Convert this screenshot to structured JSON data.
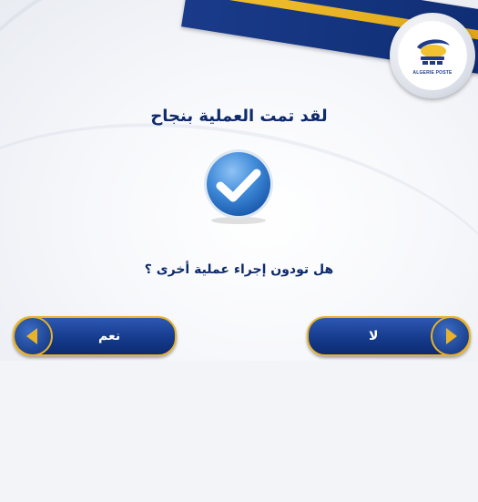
{
  "dialog": {
    "title": "لقد تمت العملية بنجاح",
    "question": "هل تودون إجراء عملية أخرى ؟"
  },
  "logo": {
    "text": "ALGERIE POSTE"
  },
  "buttons": {
    "yes_label": "نعم",
    "no_label": "لا"
  },
  "icons": {
    "success": "checkmark-icon",
    "yes_arrow": "arrow-left-icon",
    "no_arrow": "arrow-right-icon"
  },
  "colors": {
    "navy": "#0e2a6b",
    "gold": "#e8b22a",
    "check_blue": "#3f8ad8"
  }
}
